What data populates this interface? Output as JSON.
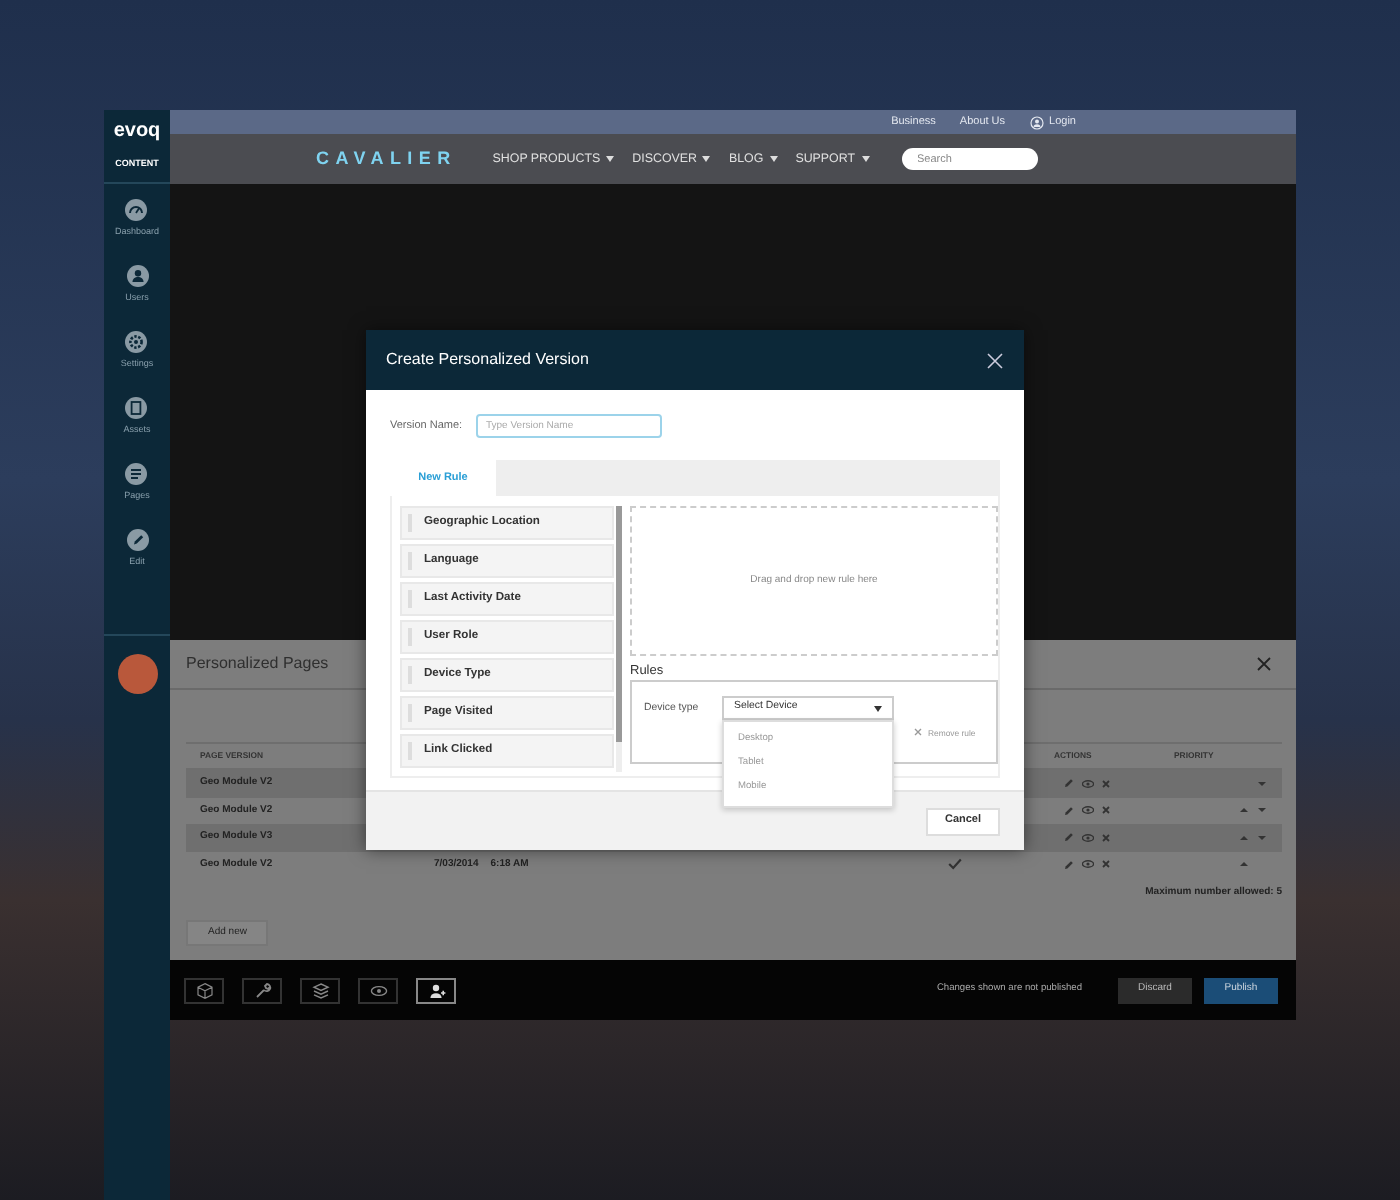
{
  "sidebar": {
    "logo": "evoq",
    "section": "CONTENT",
    "items": [
      {
        "label": "Dashboard",
        "selected": false
      },
      {
        "label": "Users",
        "selected": false
      },
      {
        "label": "Settings",
        "selected": false
      },
      {
        "label": "Assets",
        "selected": false
      },
      {
        "label": "Pages",
        "selected": false
      },
      {
        "label": "Edit",
        "selected": false
      }
    ]
  },
  "top_links": [
    {
      "label": "Business"
    },
    {
      "label": "About Us"
    },
    {
      "label": "Login"
    }
  ],
  "brand": "CAVALIER",
  "nav": [
    {
      "label": "SHOP PRODUCTS"
    },
    {
      "label": "DISCOVER"
    },
    {
      "label": "BLOG"
    },
    {
      "label": "SUPPORT"
    }
  ],
  "search": {
    "placeholder": "Search"
  },
  "personalized_pages": {
    "title": "Personalized Pages",
    "columns": [
      "PAGE VERSION",
      "ACTIONS",
      "PRIORITY"
    ],
    "rows": [
      {
        "version": "Geo Module V2",
        "can_move_up": false,
        "can_move_down": true
      },
      {
        "version": "Geo Module V2",
        "can_move_up": true,
        "can_move_down": true
      },
      {
        "version": "Geo Module V3",
        "can_move_up": true,
        "can_move_down": true
      },
      {
        "version": "Geo Module V2",
        "date": "7/03/2014",
        "time": "6:18 AM",
        "published": true,
        "can_move_up": true,
        "can_move_down": false
      }
    ],
    "limit_note": "Maximum number allowed: 5",
    "add_button": "Add new"
  },
  "toolbar": {
    "tools": [
      {
        "selected": false
      },
      {
        "selected": false
      },
      {
        "selected": false
      },
      {
        "selected": false
      },
      {
        "selected": true
      }
    ],
    "status": "Changes shown are not published",
    "buttons": [
      "Discard",
      "Publish"
    ]
  },
  "modal": {
    "title": "Create Personalized Version",
    "version_name": {
      "label": "Version Name:",
      "placeholder": "Type Version Name"
    },
    "tabs": [
      {
        "label": "New Rule",
        "selected": true
      }
    ],
    "rule_types": [
      "Geographic Location",
      "Language",
      "Last Activity Date",
      "User Role",
      "Device Type",
      "Page Visited",
      "Link Clicked"
    ],
    "drop_zone": "Drag and drop new rule here",
    "rules_heading": "Rules",
    "rules": [
      {
        "label": "Device type",
        "value": "Select Device",
        "expanded": true,
        "options": [
          {
            "label": "Desktop",
            "selected": false
          },
          {
            "label": "Tablet",
            "selected": false
          },
          {
            "label": "Mobile",
            "selected": false
          }
        ],
        "remove": "Remove rule"
      }
    ],
    "buttons": [
      "Cancel"
    ]
  }
}
